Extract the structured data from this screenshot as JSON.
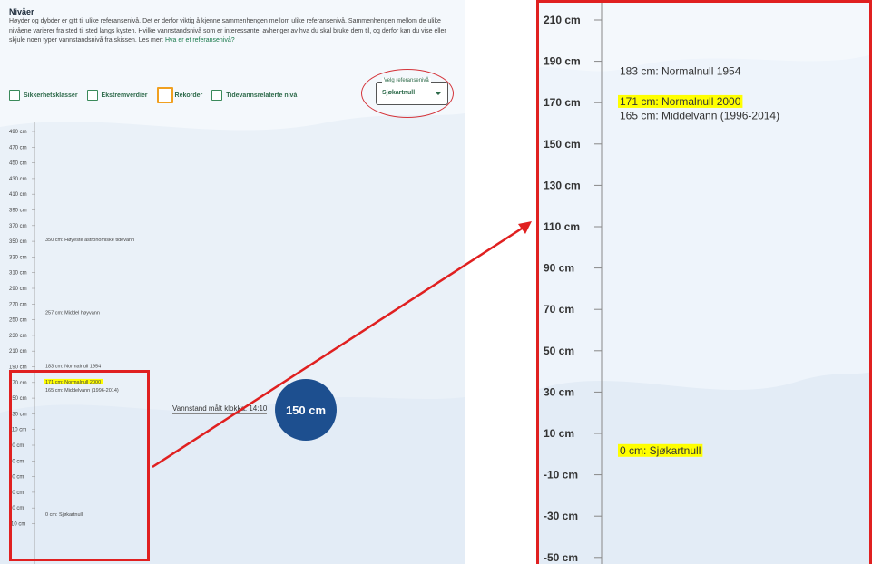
{
  "info": {
    "title": "Nivåer",
    "text": "Høyder og dybder er gitt til ulike referansenivå. Det er derfor viktig å kjenne sammenhengen mellom ulike referansenivå. Sammenhengen mellom de ulike nivåene varierer fra sted til sted langs kysten. Hvilke vannstandsnivå som er interessante, avhenger av hva du skal bruke dem til, og derfor kan du vise eller skjule noen typer vannstandsnivå fra skissen. Les mer:",
    "link": "Hva er et referansenivå?"
  },
  "checkboxes": [
    {
      "label": "Sikkerhetsklasser",
      "highlight": false
    },
    {
      "label": "Ekstremverdier",
      "highlight": false
    },
    {
      "label": "Rekorder",
      "highlight": true
    },
    {
      "label": "Tidevannsrelaterte nivå",
      "highlight": false
    }
  ],
  "ref_select": {
    "label": "Velg referansenivå",
    "value": "Sjøkartnull"
  },
  "left_axis": {
    "ticks": [
      "490 cm",
      "470 cm",
      "450 cm",
      "430 cm",
      "410 cm",
      "390 cm",
      "370 cm",
      "350 cm",
      "330 cm",
      "310 cm",
      "290 cm",
      "270 cm",
      "250 cm",
      "230 cm",
      "210 cm",
      "190 cm",
      "170 cm",
      "150 cm",
      "130 cm",
      "110 cm",
      "90 cm",
      "70 cm",
      "50 cm",
      "30 cm",
      "10 cm",
      "-10 cm"
    ],
    "markers": [
      {
        "text": "350 cm: Høyeste astronomiske tidevann",
        "value": 350,
        "highlight": false
      },
      {
        "text": "257 cm: Middel høyvann",
        "value": 257,
        "highlight": false
      },
      {
        "text": "183 cm: Normalnull 1954",
        "value": 183,
        "highlight": false
      },
      {
        "text": "171 cm: Normalnull 2000",
        "value": 171,
        "highlight": true
      },
      {
        "text": "165 cm: Middelvann (1996-2014)",
        "value": 165,
        "highlight": false
      },
      {
        "text": "0 cm: Sjøkartnull",
        "value": 0,
        "highlight": false
      }
    ]
  },
  "measurement": {
    "label": "Vannstand målt klokka: 14:10",
    "value": "150 cm"
  },
  "right_axis": {
    "ticks": [
      "210 cm",
      "190 cm",
      "170 cm",
      "150 cm",
      "130 cm",
      "110 cm",
      "90 cm",
      "70 cm",
      "50 cm",
      "30 cm",
      "10 cm",
      "-10 cm",
      "-30 cm",
      "-50 cm"
    ],
    "markers": [
      {
        "text": "183 cm: Normalnull 1954",
        "value": 183,
        "highlight": false
      },
      {
        "text": "171 cm: Normalnull 2000",
        "value": 171,
        "highlight": true
      },
      {
        "text": "165 cm: Middelvann (1996-2014)",
        "value": 165,
        "highlight": false
      },
      {
        "text": "0 cm: Sjøkartnull",
        "value": 0,
        "highlight": true
      }
    ]
  },
  "colors": {
    "highlight": "#ffff00",
    "annotation_red": "#e02020",
    "circle_blue": "#1d4f8f",
    "accent_green": "#2d6a4a"
  }
}
